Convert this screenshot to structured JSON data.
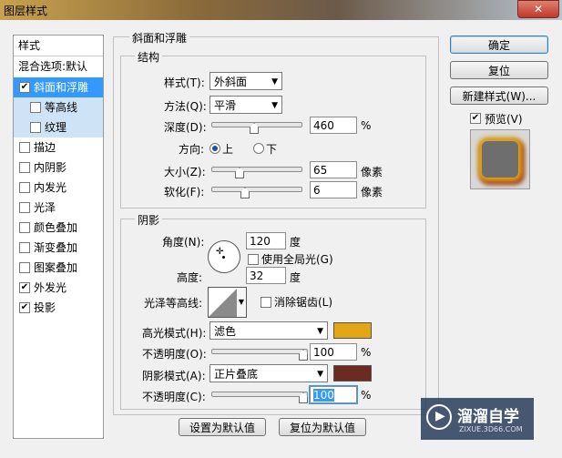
{
  "window": {
    "title": "图层样式",
    "close": "✕"
  },
  "left": {
    "items": [
      {
        "label": "样式",
        "checkbox": false,
        "checked": false
      },
      {
        "label": "混合选项:默认",
        "checkbox": false,
        "checked": false
      },
      {
        "label": "斜面和浮雕",
        "checkbox": true,
        "checked": true,
        "selected": true
      },
      {
        "label": "等高线",
        "checkbox": true,
        "checked": false,
        "sub": true
      },
      {
        "label": "纹理",
        "checkbox": true,
        "checked": false,
        "sub": true
      },
      {
        "label": "描边",
        "checkbox": true,
        "checked": false
      },
      {
        "label": "内阴影",
        "checkbox": true,
        "checked": false
      },
      {
        "label": "内发光",
        "checkbox": true,
        "checked": false
      },
      {
        "label": "光泽",
        "checkbox": true,
        "checked": false
      },
      {
        "label": "颜色叠加",
        "checkbox": true,
        "checked": false
      },
      {
        "label": "渐变叠加",
        "checkbox": true,
        "checked": false
      },
      {
        "label": "图案叠加",
        "checkbox": true,
        "checked": false
      },
      {
        "label": "外发光",
        "checkbox": true,
        "checked": true
      },
      {
        "label": "投影",
        "checkbox": true,
        "checked": true
      }
    ]
  },
  "bevel": {
    "group_title": "斜面和浮雕",
    "structure_title": "结构",
    "style_label": "样式(T):",
    "style_value": "外斜面",
    "method_label": "方法(Q):",
    "method_value": "平滑",
    "depth_label": "深度(D):",
    "depth_value": "460",
    "depth_unit": "%",
    "direction_label": "方向:",
    "dir_up": "上",
    "dir_down": "下",
    "size_label": "大小(Z):",
    "size_value": "65",
    "size_unit": "像素",
    "soften_label": "软化(F):",
    "soften_value": "6",
    "soften_unit": "像素"
  },
  "shading": {
    "title": "阴影",
    "angle_label": "角度(N):",
    "angle_value": "120",
    "angle_unit": "度",
    "global_light_label": "使用全局光(G)",
    "altitude_label": "高度:",
    "altitude_value": "32",
    "altitude_unit": "度",
    "gloss_label": "光泽等高线:",
    "antialias_label": "消除锯齿(L)",
    "highlight_label": "高光模式(H):",
    "highlight_value": "滤色",
    "highlight_color": "#e3a716",
    "op1_label": "不透明度(O):",
    "op1_value": "100",
    "op1_unit": "%",
    "shadow_label": "阴影模式(A):",
    "shadow_value": "正片叠底",
    "shadow_color": "#6b2a22",
    "op2_label": "不透明度(C):",
    "op2_value": "100",
    "op2_unit": "%"
  },
  "footer": {
    "set_default": "设置为默认值",
    "reset_default": "复位为默认值"
  },
  "right": {
    "ok": "确定",
    "reset": "复位",
    "new_style": "新建样式(W)...",
    "preview_label": "预览(V)"
  },
  "watermark": {
    "name": "溜溜自学",
    "url": "ZIXUE.3D66.COM"
  }
}
